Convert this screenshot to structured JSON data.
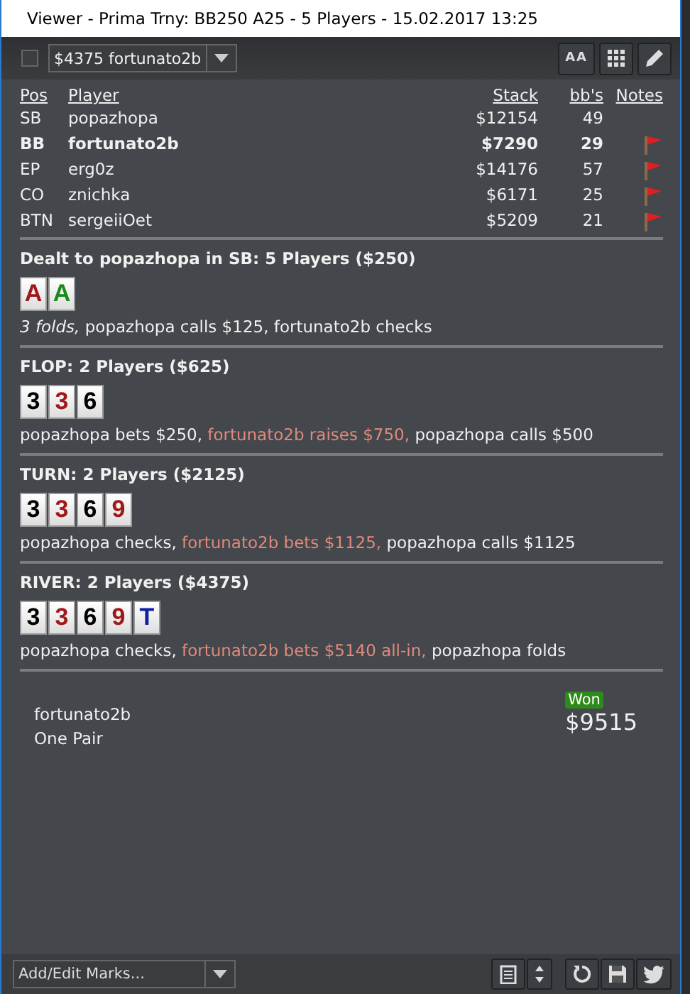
{
  "window": {
    "title": "Viewer - Prima Trny: BB250 A25 - 5 Players - 15.02.2017 13:25"
  },
  "toolbar": {
    "checked": false,
    "hand_select": "$4375 fortunato2b",
    "buttons": [
      {
        "label": "AA",
        "kind": "text"
      },
      {
        "kind": "grid"
      },
      {
        "kind": "pencil"
      }
    ]
  },
  "players": {
    "columns": [
      "Pos",
      "Player",
      "Stack",
      "bb's",
      "Notes"
    ],
    "rows": [
      {
        "pos": "SB",
        "player": "popazhopa",
        "stack": "$12154",
        "bbs": "49",
        "hero": false,
        "note": false
      },
      {
        "pos": "BB",
        "player": "fortunato2b",
        "stack": "$7290",
        "bbs": "29",
        "hero": true,
        "note": true
      },
      {
        "pos": "EP",
        "player": "erg0z",
        "stack": "$14176",
        "bbs": "57",
        "hero": false,
        "note": true
      },
      {
        "pos": "CO",
        "player": "znichka",
        "stack": "$6171",
        "bbs": "25",
        "hero": false,
        "note": true
      },
      {
        "pos": "BTN",
        "player": "sergeiiOet",
        "stack": "$5209",
        "bbs": "21",
        "hero": false,
        "note": true
      }
    ]
  },
  "streets": [
    {
      "title": "Dealt to popazhopa in SB: 5 Players ($250)",
      "cards": [
        {
          "rank": "A",
          "color": "#a01818"
        },
        {
          "rank": "A",
          "color": "#1a8a1a"
        }
      ],
      "actions": [
        {
          "text": "3 folds,",
          "kind": "fold"
        },
        {
          "text": "popazhopa calls $125, fortunato2b checks",
          "kind": "plain"
        }
      ]
    },
    {
      "title": "FLOP: 2 Players ($625)",
      "cards": [
        {
          "rank": "3",
          "color": "#000000"
        },
        {
          "rank": "3",
          "color": "#a01818"
        },
        {
          "rank": "6",
          "color": "#000000"
        }
      ],
      "actions": [
        {
          "text": "popazhopa bets $250,",
          "kind": "plain"
        },
        {
          "text": "fortunato2b raises $750,",
          "kind": "hero"
        },
        {
          "text": "popazhopa calls $500",
          "kind": "plain"
        }
      ]
    },
    {
      "title": "TURN: 2 Players ($2125)",
      "cards": [
        {
          "rank": "3",
          "color": "#000000"
        },
        {
          "rank": "3",
          "color": "#a01818"
        },
        {
          "rank": "6",
          "color": "#000000"
        },
        {
          "rank": "9",
          "color": "#a01818"
        }
      ],
      "actions": [
        {
          "text": "popazhopa checks,",
          "kind": "plain"
        },
        {
          "text": "fortunato2b bets $1125,",
          "kind": "hero"
        },
        {
          "text": "popazhopa calls $1125",
          "kind": "plain"
        }
      ]
    },
    {
      "title": "RIVER: 2 Players ($4375)",
      "cards": [
        {
          "rank": "3",
          "color": "#000000"
        },
        {
          "rank": "3",
          "color": "#a01818"
        },
        {
          "rank": "6",
          "color": "#000000"
        },
        {
          "rank": "9",
          "color": "#a01818"
        },
        {
          "rank": "T",
          "color": "#1020a0"
        }
      ],
      "actions": [
        {
          "text": "popazhopa checks,",
          "kind": "plain"
        },
        {
          "text": "fortunato2b bets $5140 all-in,",
          "kind": "hero"
        },
        {
          "text": "popazhopa folds",
          "kind": "plain"
        }
      ]
    }
  ],
  "result": {
    "player": "fortunato2b",
    "hand": "One Pair",
    "badge": "Won",
    "amount": "$9515"
  },
  "footer": {
    "marks_select": "Add/Edit Marks...",
    "buttons": [
      {
        "kind": "notes"
      },
      {
        "kind": "updown"
      },
      {
        "kind": "refresh"
      },
      {
        "kind": "save"
      },
      {
        "kind": "twitter"
      }
    ]
  }
}
